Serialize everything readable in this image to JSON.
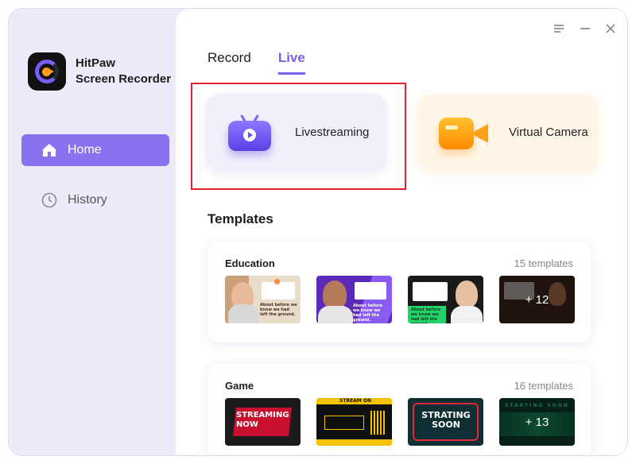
{
  "app": {
    "name_line1": "HitPaw",
    "name_line2": "Screen Recorder"
  },
  "sidebar": {
    "items": [
      {
        "label": "Home",
        "icon": "home-icon",
        "active": true
      },
      {
        "label": "History",
        "icon": "clock-icon",
        "active": false
      }
    ]
  },
  "window_controls": [
    "menu-icon",
    "minimize-icon",
    "close-icon"
  ],
  "tabs": [
    {
      "label": "Record",
      "active": false
    },
    {
      "label": "Live",
      "active": true
    }
  ],
  "modes": [
    {
      "label": "Livestreaming",
      "icon": "tv-play-icon",
      "highlighted": true
    },
    {
      "label": "Virtual Camera",
      "icon": "video-camera-icon",
      "highlighted": false
    }
  ],
  "templates": {
    "title": "Templates",
    "groups": [
      {
        "name": "Education",
        "count": "15 templates",
        "thumbs": [
          {
            "caption": "About before we know we had left the ground."
          },
          {
            "caption": "About before we know we had left the ground."
          },
          {
            "caption": "About before we know we had left the ground."
          },
          {
            "more": "+ 12"
          }
        ]
      },
      {
        "name": "Game",
        "count": "16 templates",
        "thumbs": [
          {
            "caption": "STREAMING NOW"
          },
          {
            "caption": "STREAM ON"
          },
          {
            "caption": "STRATING SOON"
          },
          {
            "caption": "STARTING SOON",
            "more": "+ 13"
          }
        ]
      }
    ]
  },
  "colors": {
    "accent": "#7b62ee",
    "highlight_border": "#e0212e",
    "sidebar_bg": "#ecebf9"
  }
}
